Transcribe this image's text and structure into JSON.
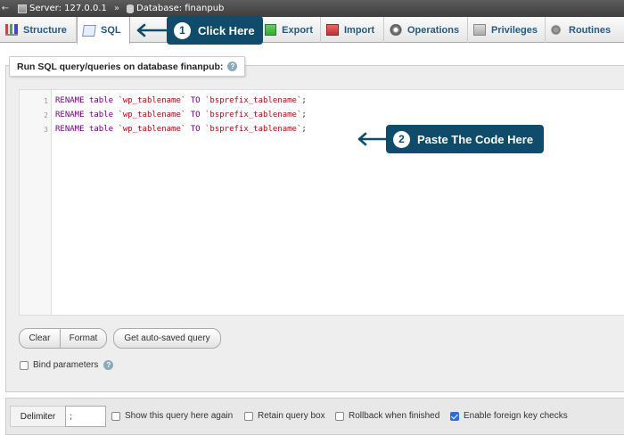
{
  "breadcrumb": {
    "server_label": "Server: 127.0.0.1",
    "separator": "»",
    "database_label": "Database: finanpub"
  },
  "tabs": [
    {
      "label": "Structure",
      "icon": "structure-icon"
    },
    {
      "label": "SQL",
      "icon": "sql-icon"
    },
    {
      "label": "Export",
      "icon": "export-icon"
    },
    {
      "label": "Import",
      "icon": "import-icon"
    },
    {
      "label": "Operations",
      "icon": "operations-icon"
    },
    {
      "label": "Privileges",
      "icon": "privileges-icon"
    },
    {
      "label": "Routines",
      "icon": "routines-icon"
    }
  ],
  "callouts": [
    {
      "number": "1",
      "text": "Click Here"
    },
    {
      "number": "2",
      "text": "Paste The Code Here"
    }
  ],
  "panel": {
    "legend": "Run SQL query/queries on database finanpub:"
  },
  "editor": {
    "lines": [
      {
        "n": "1",
        "kw1": "RENAME",
        "kw2": "table",
        "from": "`wp_tablename`",
        "kw3": "TO",
        "to": "`bsprefix_tablename`",
        "end": ";"
      },
      {
        "n": "2",
        "kw1": "RENAME",
        "kw2": "table",
        "from": "`wp_tablename`",
        "kw3": "TO",
        "to": "`bsprefix_tablename`",
        "end": ";"
      },
      {
        "n": "3",
        "kw1": "RENAME",
        "kw2": "table",
        "from": "`wp_tablename`",
        "kw3": "TO",
        "to": "`bsprefix_tablename`",
        "end": ";"
      }
    ]
  },
  "buttons": {
    "clear": "Clear",
    "format": "Format",
    "autosaved": "Get auto-saved query"
  },
  "bind_parameters": "Bind parameters",
  "footer": {
    "delimiter_label": "Delimiter",
    "delimiter_value": ";",
    "options": [
      {
        "label": "Show this query here again",
        "checked": false
      },
      {
        "label": "Retain query box",
        "checked": false
      },
      {
        "label": "Rollback when finished",
        "checked": false
      },
      {
        "label": "Enable foreign key checks",
        "checked": true
      }
    ]
  },
  "colors": {
    "callout": "#0f4c6b",
    "tab_text": "#235a81",
    "checkbox_checked": "#2b6fd6"
  }
}
